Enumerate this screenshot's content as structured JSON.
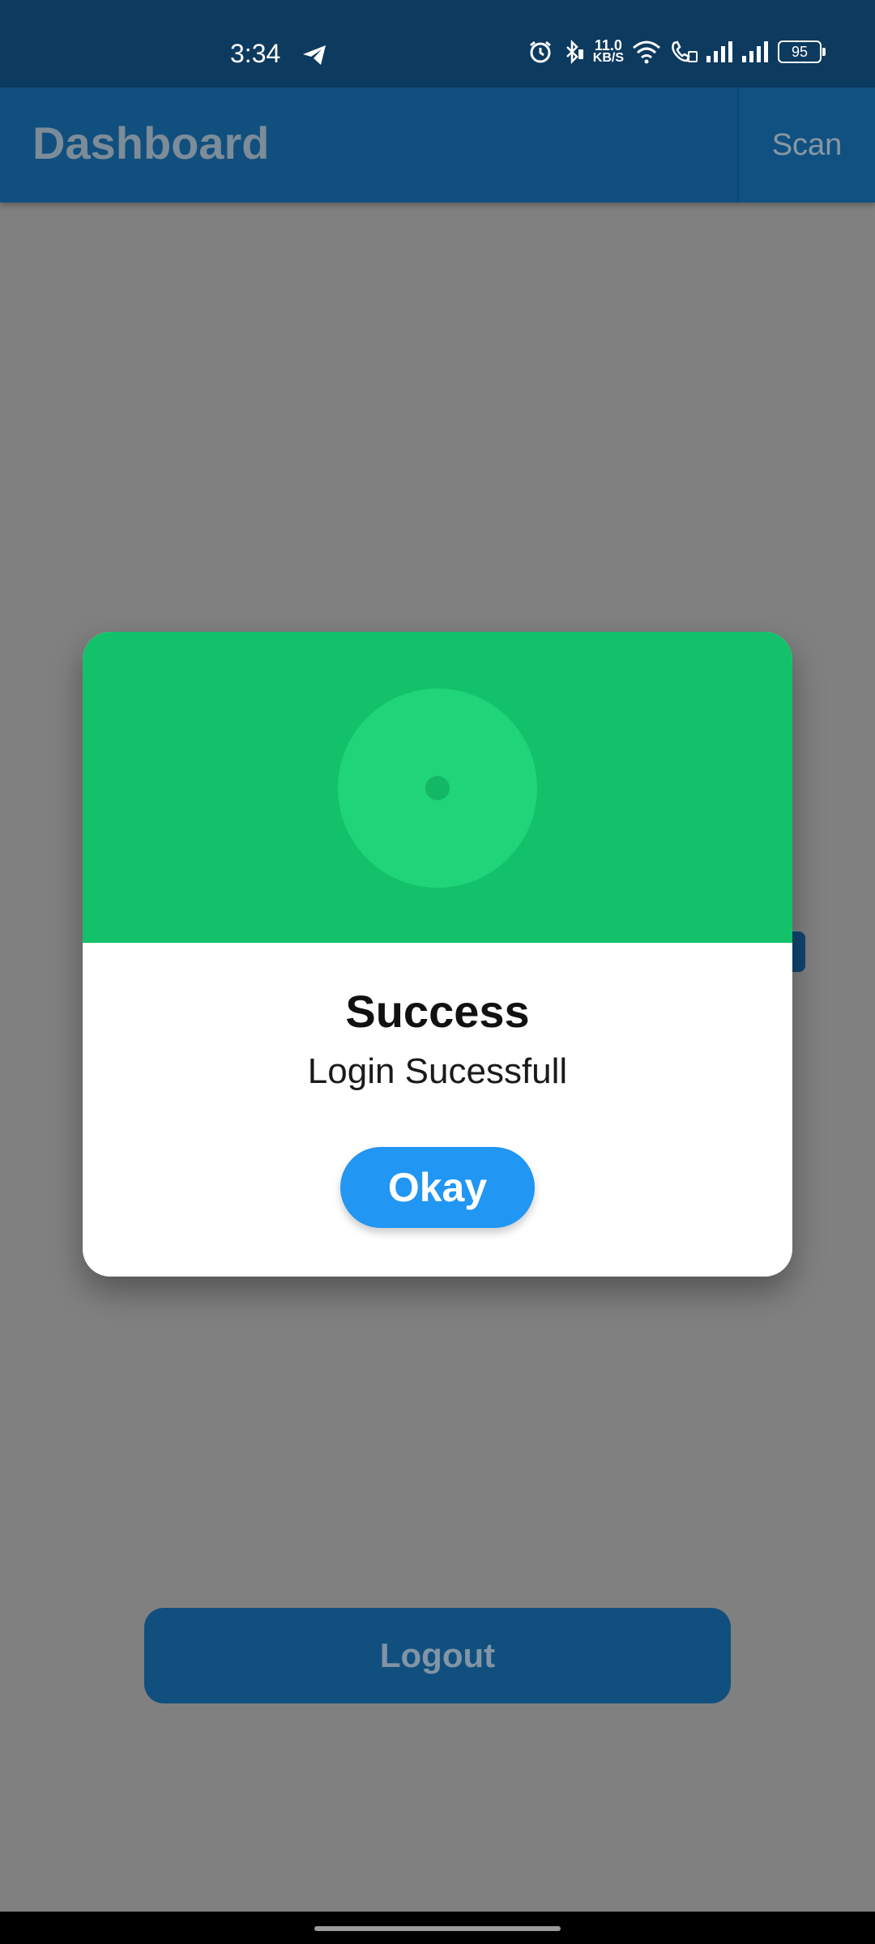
{
  "status_bar": {
    "time": "3:34",
    "speed_value": "11.0",
    "speed_unit": "KB/S",
    "battery": "95",
    "icons": [
      "telegram-icon",
      "alarm-icon",
      "bluetooth-icon",
      "wifi-icon",
      "wifi-calling-icon",
      "signal-icon",
      "signal-icon"
    ]
  },
  "app_bar": {
    "title": "Dashboard",
    "scan_label": "Scan"
  },
  "main": {
    "logout_label": "Logout"
  },
  "dialog": {
    "title": "Success",
    "message": "Login Sucessfull",
    "okay_label": "Okay",
    "header_color": "#13c16b",
    "button_color": "#2196f3"
  }
}
